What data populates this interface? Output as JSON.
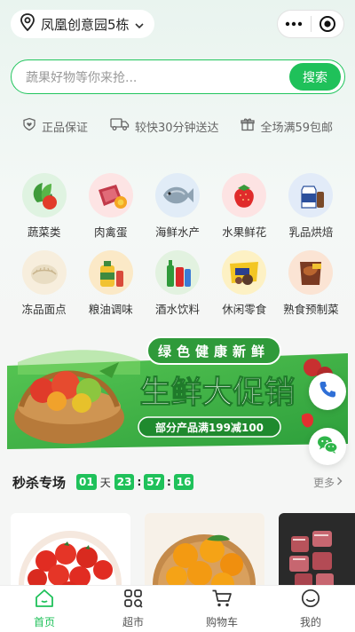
{
  "header": {
    "location": "凤凰创意园5栋",
    "location_icon": "map-pin-icon",
    "capsule_more_icon": "more-dots-icon",
    "capsule_close_icon": "target-icon"
  },
  "search": {
    "placeholder": "蔬果好物等你来抢...",
    "button_label": "搜索"
  },
  "guarantees": [
    {
      "icon": "heart-shield-icon",
      "label": "正品保证"
    },
    {
      "icon": "truck-icon",
      "label": "较快30分钟送达"
    },
    {
      "icon": "gift-icon",
      "label": "全场满59包邮"
    }
  ],
  "categories": [
    {
      "label": "蔬菜类",
      "icon": "vegetable-icon"
    },
    {
      "label": "肉禽蛋",
      "icon": "meat-icon"
    },
    {
      "label": "海鲜水产",
      "icon": "fish-icon"
    },
    {
      "label": "水果鲜花",
      "icon": "strawberry-icon"
    },
    {
      "label": "乳品烘焙",
      "icon": "milk-icon"
    },
    {
      "label": "冻品面点",
      "icon": "dumpling-icon"
    },
    {
      "label": "粮油调味",
      "icon": "oil-icon"
    },
    {
      "label": "酒水饮料",
      "icon": "drinks-icon"
    },
    {
      "label": "休闲零食",
      "icon": "snack-icon"
    },
    {
      "label": "熟食预制菜",
      "icon": "cooked-food-icon"
    }
  ],
  "banner": {
    "top_text": "绿色健康新鲜",
    "main_text": "生鲜大促销",
    "sub_text": "部分产品满199减100"
  },
  "float_buttons": {
    "phone_icon": "phone-icon",
    "wechat_icon": "wechat-icon"
  },
  "flash_sale": {
    "title": "秒杀专场",
    "days": "01",
    "day_unit": "天",
    "hours": "23",
    "minutes": "57",
    "seconds": "16",
    "colon": ":",
    "more_label": "更多"
  },
  "products": [
    {
      "icon": "tomato-image"
    },
    {
      "icon": "orange-image"
    },
    {
      "icon": "meat-cubes-image"
    }
  ],
  "tabbar": [
    {
      "label": "首页",
      "icon": "home-icon",
      "active": true
    },
    {
      "label": "超市",
      "icon": "grid-icon",
      "active": false
    },
    {
      "label": "购物车",
      "icon": "cart-icon",
      "active": false
    },
    {
      "label": "我的",
      "icon": "smile-icon",
      "active": false
    }
  ],
  "colors": {
    "accent": "#1fc15a",
    "banner_green": "#3cb94a"
  }
}
